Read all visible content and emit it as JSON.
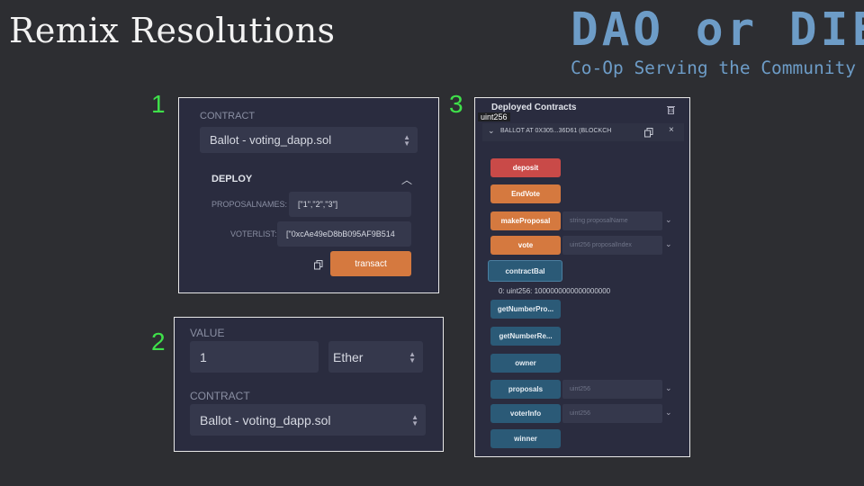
{
  "slide": {
    "title": "Remix Resolutions"
  },
  "logo": {
    "main": "DAO or DIE",
    "tagline": "Co-Op Serving the Community"
  },
  "numbers": {
    "one": "1",
    "two": "2",
    "three": "3"
  },
  "panel1": {
    "contract_label": "CONTRACT",
    "contract_value": "Ballot - voting_dapp.sol",
    "deploy_label": "DEPLOY",
    "proposalnames_label": "PROPOSALNAMES:",
    "proposalnames_value": "[\"1\",\"2\",\"3\"]",
    "voterlist_label": "VOTERLIST:",
    "voterlist_value": "[\"0xcAe49eD8bB095AF9B514",
    "transact_label": "transact"
  },
  "panel2": {
    "value_label": "VALUE",
    "value_amount": "1",
    "unit": "Ether",
    "contract_label": "CONTRACT",
    "contract_value": "Ballot - voting_dapp.sol"
  },
  "panel3": {
    "header": "Deployed Contracts",
    "tooltip": "uint256",
    "instance_label": "BALLOT AT 0X305...36D61 (BLOCKCH",
    "buttons": {
      "deposit": "deposit",
      "endvote": "EndVote",
      "makeproposal": "makeProposal",
      "vote": "vote",
      "contractbal": "contractBal",
      "getnumberpro": "getNumberPro...",
      "getnumberre": "getNumberRe...",
      "owner": "owner",
      "proposals": "proposals",
      "voterinfo": "voterInfo",
      "winner": "winner"
    },
    "args": {
      "makeproposal": "string proposalName",
      "vote": "uint256 proposalIndex",
      "proposals": "uint256",
      "voterinfo": "uint256"
    },
    "result": "0: uint256: 1000000000000000000"
  },
  "colors": {
    "accent": "#d5793f",
    "danger": "#c94a48",
    "call": "#2b5a77",
    "highlight": "#3fe04a",
    "logo": "#6d9cc7"
  }
}
